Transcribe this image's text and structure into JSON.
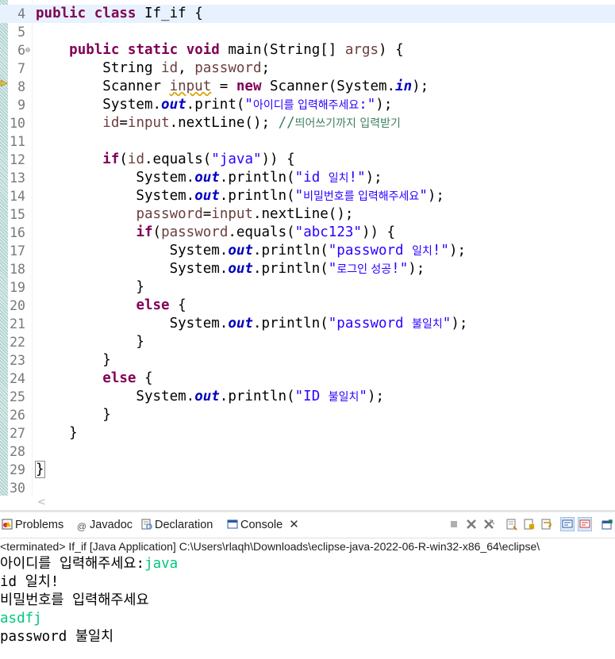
{
  "editor": {
    "lines": [
      {
        "n": "4",
        "html": "<span class=\"kw\">public</span> <span class=\"kw\">class</span> If_if {"
      },
      {
        "n": "5",
        "html": ""
      },
      {
        "n": "6",
        "fold": true,
        "html": "    <span class=\"kw\">public</span> <span class=\"kw\">static</span> <span class=\"kw\">void</span> main(String[] <span class=\"var\">args</span>) {"
      },
      {
        "n": "7",
        "html": "        String <span class=\"var\">id</span>, <span class=\"var\">password</span>;"
      },
      {
        "n": "8",
        "html": "        Scanner <span class=\"var warn\">input</span> = <span class=\"kw\">new</span> Scanner(System.<span class=\"fld\">in</span>);"
      },
      {
        "n": "9",
        "html": "        System.<span class=\"fld\">out</span>.print(<span class=\"str\">\"<span class=\"ko\">아이디를 입력해주세요</span>:\"</span>);"
      },
      {
        "n": "10",
        "html": "        <span class=\"var\">id</span>=<span class=\"var\">input</span>.nextLine(); <span class=\"cmt\">//<span class=\"ko\">띄어쓰기까지 입력받기</span></span>"
      },
      {
        "n": "11",
        "html": ""
      },
      {
        "n": "12",
        "html": "        <span class=\"kw\">if</span>(<span class=\"var\">id</span>.equals(<span class=\"str\">\"java\"</span>)) {"
      },
      {
        "n": "13",
        "html": "            System.<span class=\"fld\">out</span>.println(<span class=\"str\">\"id <span class=\"ko\">일치</span>!\"</span>);"
      },
      {
        "n": "14",
        "html": "            System.<span class=\"fld\">out</span>.println(<span class=\"str\">\"<span class=\"ko\">비밀번호를 입력해주세요</span>\"</span>);"
      },
      {
        "n": "15",
        "html": "            <span class=\"var\">password</span>=<span class=\"var\">input</span>.nextLine();"
      },
      {
        "n": "16",
        "html": "            <span class=\"kw\">if</span>(<span class=\"var\">password</span>.equals(<span class=\"str\">\"abc123\"</span>)) {"
      },
      {
        "n": "17",
        "html": "                System.<span class=\"fld\">out</span>.println(<span class=\"str\">\"password <span class=\"ko\">일치</span>!\"</span>);"
      },
      {
        "n": "18",
        "html": "                System.<span class=\"fld\">out</span>.println(<span class=\"str\">\"<span class=\"ko\">로그인 성공</span>!\"</span>);"
      },
      {
        "n": "19",
        "html": "            }"
      },
      {
        "n": "20",
        "html": "            <span class=\"kw\">else</span> {"
      },
      {
        "n": "21",
        "html": "                System.<span class=\"fld\">out</span>.println(<span class=\"str\">\"password <span class=\"ko\">불일치</span>\"</span>);"
      },
      {
        "n": "22",
        "html": "            }"
      },
      {
        "n": "23",
        "html": "        }"
      },
      {
        "n": "24",
        "html": "        <span class=\"kw\">else</span> {"
      },
      {
        "n": "25",
        "html": "            System.<span class=\"fld\">out</span>.println(<span class=\"str\">\"ID <span class=\"ko\">불일치</span>\"</span>);"
      },
      {
        "n": "26",
        "html": "        }"
      },
      {
        "n": "27",
        "html": "    }"
      },
      {
        "n": "28",
        "html": ""
      },
      {
        "n": "29",
        "html": "<span class=\"bracket-box\">}</span>"
      },
      {
        "n": "30",
        "html": ""
      }
    ]
  },
  "tabs": [
    {
      "label": "Problems",
      "icon": "problems-icon"
    },
    {
      "label": "Javadoc",
      "icon": "javadoc-icon"
    },
    {
      "label": "Declaration",
      "icon": "declaration-icon"
    },
    {
      "label": "Console",
      "icon": "console-icon",
      "active": true
    }
  ],
  "console": {
    "status": "<terminated> If_if [Java Application] C:\\Users\\rlaqh\\Downloads\\eclipse-java-2022-06-R-win32-x86_64\\eclipse\\",
    "output": [
      {
        "parts": [
          {
            "t": "아이디를 입력해주세요:",
            "k": "std"
          },
          {
            "t": "java",
            "k": "in"
          }
        ]
      },
      {
        "parts": [
          {
            "t": "id 일치!",
            "k": "std"
          }
        ]
      },
      {
        "parts": [
          {
            "t": "비밀번호를 입력해주세요",
            "k": "std"
          }
        ]
      },
      {
        "parts": [
          {
            "t": "asdfj",
            "k": "in"
          }
        ]
      },
      {
        "parts": [
          {
            "t": "password 불일치",
            "k": "std"
          }
        ]
      }
    ]
  },
  "colors": {
    "keyword": "#7f0055",
    "string": "#2a00ff",
    "field": "#0000c0",
    "comment": "#3f7f5f",
    "input": "#00c87d",
    "current_line": "#e8f2fe"
  }
}
